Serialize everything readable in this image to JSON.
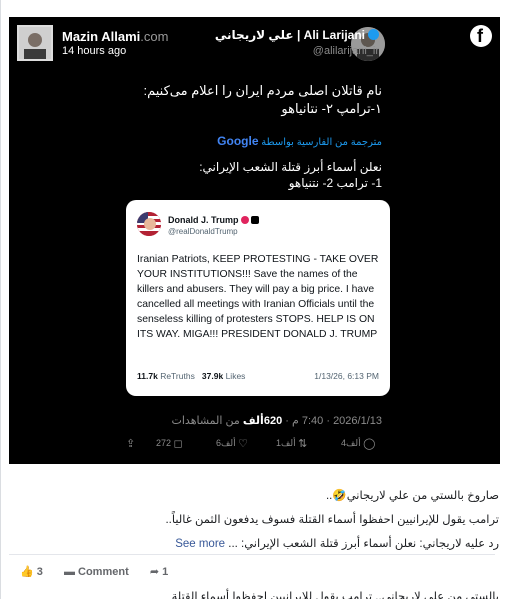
{
  "fb_post": {
    "author": "Mazin Allami",
    "author_domain": ".com",
    "time": "14 hours ago",
    "logo": "facebook-logo"
  },
  "x_post": {
    "display_name": "علي لاريجاني | Ali Larijani",
    "handle": "@alilarijani_ir",
    "verified_color": "#1d9bf0",
    "text_fa_line1": "نام قاتلان اصلی مردم ایران را اعلام می‌کنیم:",
    "text_fa_line2": "۱-ترامپ ۲- نتانیاهو",
    "translate_label": "مترجمة من الفارسية بواسطة",
    "translate_brand": "Google",
    "text_ar_line1": "نعلن أسماء أبرز قتلة الشعب الإيراني:",
    "text_ar_line2": "1- ترامب 2- نتنياهو",
    "meta_time": "2026/1/13 · 7:40 م ·",
    "meta_views_num": "620ألف",
    "meta_views_label": "من المشاهدات",
    "actions": {
      "replies": "4ألف",
      "reposts": "1ألف",
      "likes": "6ألف",
      "bookmarks": "272"
    }
  },
  "quoted": {
    "name": "Donald J. Trump",
    "handle": "@realDonaldTrump",
    "body": "Iranian Patriots, KEEP PROTESTING - TAKE OVER YOUR INSTITUTIONS!!! Save the names of the killers and abusers. They will pay a big price. I have cancelled all meetings with Iranian Officials until the senseless killing of protesters STOPS. HELP IS ON ITS WAY. MIGA!!! PRESIDENT DONALD J. TRUMP",
    "retruths_num": "11.7k",
    "retruths_label": "ReTruths",
    "likes_num": "37.9k",
    "likes_label": "Likes",
    "date": "1/13/26, 6:13 PM"
  },
  "caption": {
    "line1": "صاروخ بالستي من علي لاريجاني🤣..",
    "line2": "ترامب يقول للإيرانيين احفظوا أسماء القتلة فسوف يدفعون الثمن غالياً..",
    "line3": "رد عليه لاريجاني: نعلن أسماء أبرز قتلة الشعب الإيراني:  ...",
    "see_more": "See more"
  },
  "reactions": {
    "likes_count": "3",
    "comment_label": "Comment",
    "shares_count": "1"
  },
  "bottom_text": "بالستي من علي لاريجاني.. ترامب يقول للإيرانيين احفظوا أسماء القتلة"
}
